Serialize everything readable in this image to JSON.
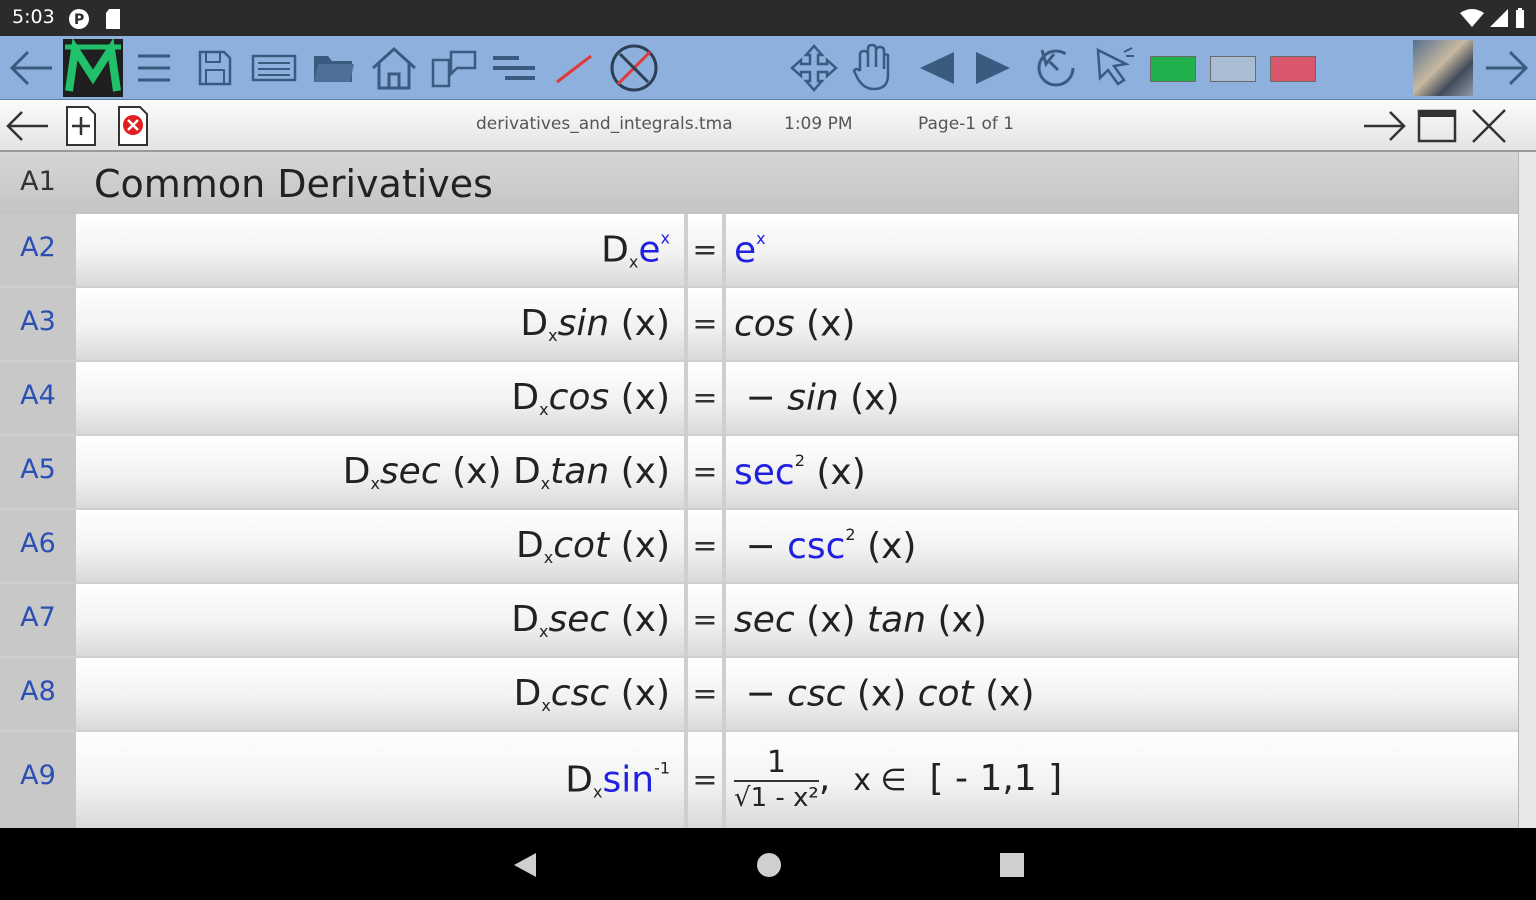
{
  "status_bar": {
    "time": "5:03"
  },
  "subbar": {
    "filename": "derivatives_and_integrals.tma",
    "clock": "1:09 PM",
    "page": "Page-1  of  1"
  },
  "colors": {
    "swatch_1": "#22b14c",
    "swatch_2": "#a9bcd1",
    "swatch_3": "#d9566d",
    "toolbar": "#8db1dc"
  },
  "sheet": {
    "title_row": {
      "label": "A1",
      "text": "Common  Derivatives"
    },
    "rows": [
      {
        "label": "A2",
        "eq": "="
      },
      {
        "label": "A3",
        "eq": "="
      },
      {
        "label": "A4",
        "eq": "="
      },
      {
        "label": "A5",
        "eq": "="
      },
      {
        "label": "A6",
        "eq": "="
      },
      {
        "label": "A7",
        "eq": "="
      },
      {
        "label": "A8",
        "eq": "="
      },
      {
        "label": "A9",
        "eq": "="
      }
    ],
    "math": {
      "D": "D",
      "x": "x",
      "e": "e",
      "sin": "sin",
      "cos": "cos",
      "tan": "tan",
      "sec": "sec",
      "cot": "cot",
      "csc": "csc",
      "lp": "(",
      "rp": ")",
      "minus": "−",
      "sq": "2",
      "inv": "-1",
      "one": "1",
      "radicand": "√1 - x²",
      "in": "x  ∈",
      "interval": "[ - 1,1 ]",
      "comma": ","
    }
  }
}
